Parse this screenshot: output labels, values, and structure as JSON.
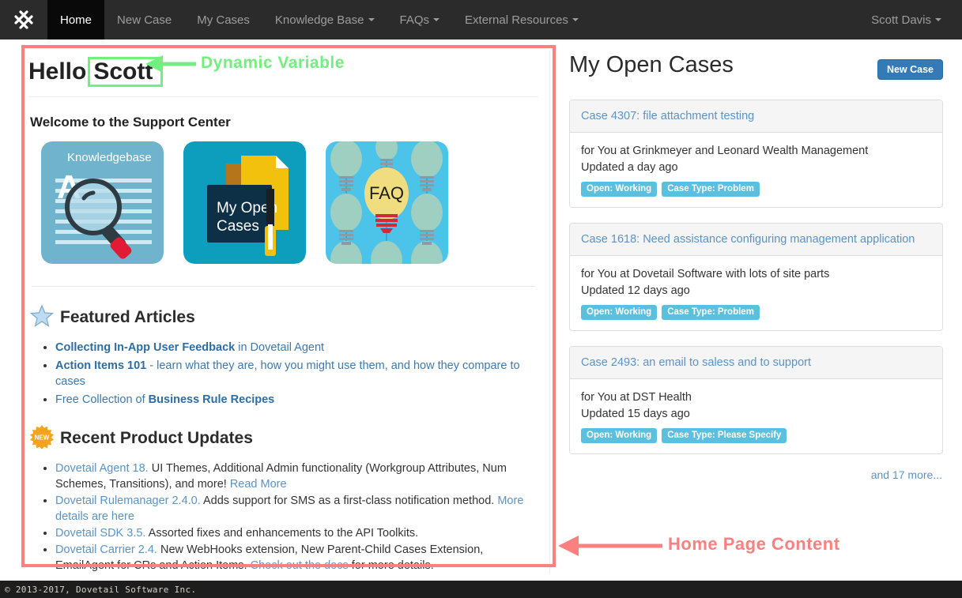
{
  "navbar": {
    "logo_icon": "dovetail-weave-logo",
    "items": [
      {
        "label": "Home",
        "active": true,
        "caret": false
      },
      {
        "label": "New Case",
        "active": false,
        "caret": false
      },
      {
        "label": "My Cases",
        "active": false,
        "caret": false
      },
      {
        "label": "Knowledge Base",
        "active": false,
        "caret": true
      },
      {
        "label": "FAQs",
        "active": false,
        "caret": true
      },
      {
        "label": "External Resources",
        "active": false,
        "caret": true
      }
    ],
    "user": {
      "name": "Scott Davis",
      "caret": true
    }
  },
  "left": {
    "greeting_prefix": "Hello",
    "greeting_name": "Scott",
    "welcome": "Welcome to the Support Center",
    "tiles": [
      {
        "name": "knowledgebase-tile",
        "label": "Knowledgebase"
      },
      {
        "name": "my-open-cases-tile",
        "label": "My Open\nCases",
        "line1": "My Open",
        "line2": "Cases"
      },
      {
        "name": "faq-tile",
        "label": "FAQ"
      }
    ],
    "featured": {
      "icon": "star-icon",
      "heading": "Featured Articles",
      "items": [
        {
          "bold": "Collecting In-App User Feedback",
          "rest": " in Dovetail Agent"
        },
        {
          "bold": "Action Items 101",
          "rest": " - learn what they are, how you might use them, and how they compare to cases"
        },
        {
          "pre": "Free Collection of ",
          "bold": "Business Rule Recipes",
          "rest": ""
        }
      ]
    },
    "updates": {
      "icon": "new-starburst-icon",
      "heading": "Recent Product Updates",
      "items": [
        {
          "link": "Dovetail Agent 18.",
          "text": " UI Themes, Additional Admin functionality (Workgroup Attributes, Num Schemes, Transitions), and more! ",
          "link2": "Read More",
          "tail": ""
        },
        {
          "link": "Dovetail Rulemanager 2.4.0.",
          "text": " Adds support for SMS as a first-class notification method. ",
          "link2": "More details are here",
          "tail": ""
        },
        {
          "link": "Dovetail SDK 3.5.",
          "text": " Assorted fixes and enhancements to the API Toolkits.",
          "link2": "",
          "tail": ""
        },
        {
          "link": "Dovetail Carrier 2.4.",
          "text": " New WebHooks extension, New Parent-Child Cases Extension, EmailAgent for CRs and Action Items. ",
          "link2": "Check out the docs",
          "tail": " for more details."
        }
      ]
    }
  },
  "right": {
    "title": "My Open Cases",
    "new_case_button": "New Case",
    "cases": [
      {
        "title": "Case 4307: file attachment testing",
        "for_line": "for You at Grinkmeyer and Leonard Wealth Management",
        "updated": "Updated a day ago",
        "badges": [
          "Open: Working",
          "Case Type: Problem"
        ]
      },
      {
        "title": "Case 1618: Need assistance configuring management application",
        "for_line": "for You at Dovetail Software with lots of site parts",
        "updated": "Updated 12 days ago",
        "badges": [
          "Open: Working",
          "Case Type: Problem"
        ]
      },
      {
        "title": "Case 2493: an email to saless and to support",
        "for_line": "for You at DST Health",
        "updated": "Updated 15 days ago",
        "badges": [
          "Open: Working",
          "Case Type: Please Specify"
        ]
      }
    ],
    "more_link": "and 17 more..."
  },
  "footer": {
    "copyright": "© 2013-2017, Dovetail Software Inc."
  },
  "annotations": {
    "green_label": "Dynamic Variable",
    "green_color": "#72ef7f",
    "red_label": "Home Page Content",
    "red_color": "#fb8080"
  },
  "colors": {
    "navbar_bg": "#2b2b2b",
    "nav_active_bg": "#090909",
    "primary_button": "#337ab7",
    "badge": "#5bc0de",
    "link": "#2e6da4",
    "footer_bg": "#1d1d1d"
  }
}
